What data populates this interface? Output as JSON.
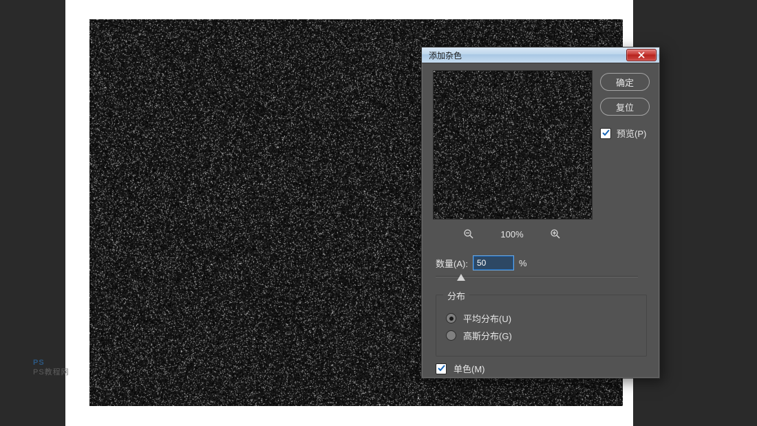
{
  "dialog": {
    "title": "添加杂色",
    "buttons": {
      "ok": "确定",
      "reset": "复位"
    },
    "preview_checkbox": {
      "label": "预览(P)",
      "checked": true
    },
    "zoom": {
      "level": "100%"
    },
    "amount": {
      "label": "数量(A):",
      "value": "50",
      "unit": "%"
    },
    "slider": {
      "min": 0,
      "max": 400,
      "value": 50
    },
    "distribution": {
      "legend": "分布",
      "options": [
        {
          "id": "uniform",
          "label": "平均分布(U)",
          "checked": true
        },
        {
          "id": "gaussian",
          "label": "高斯分布(G)",
          "checked": false
        }
      ]
    },
    "monochrome": {
      "label": "单色(M)",
      "checked": true
    }
  },
  "watermark": {
    "line1": "PS",
    "line2": "PS教程网"
  }
}
